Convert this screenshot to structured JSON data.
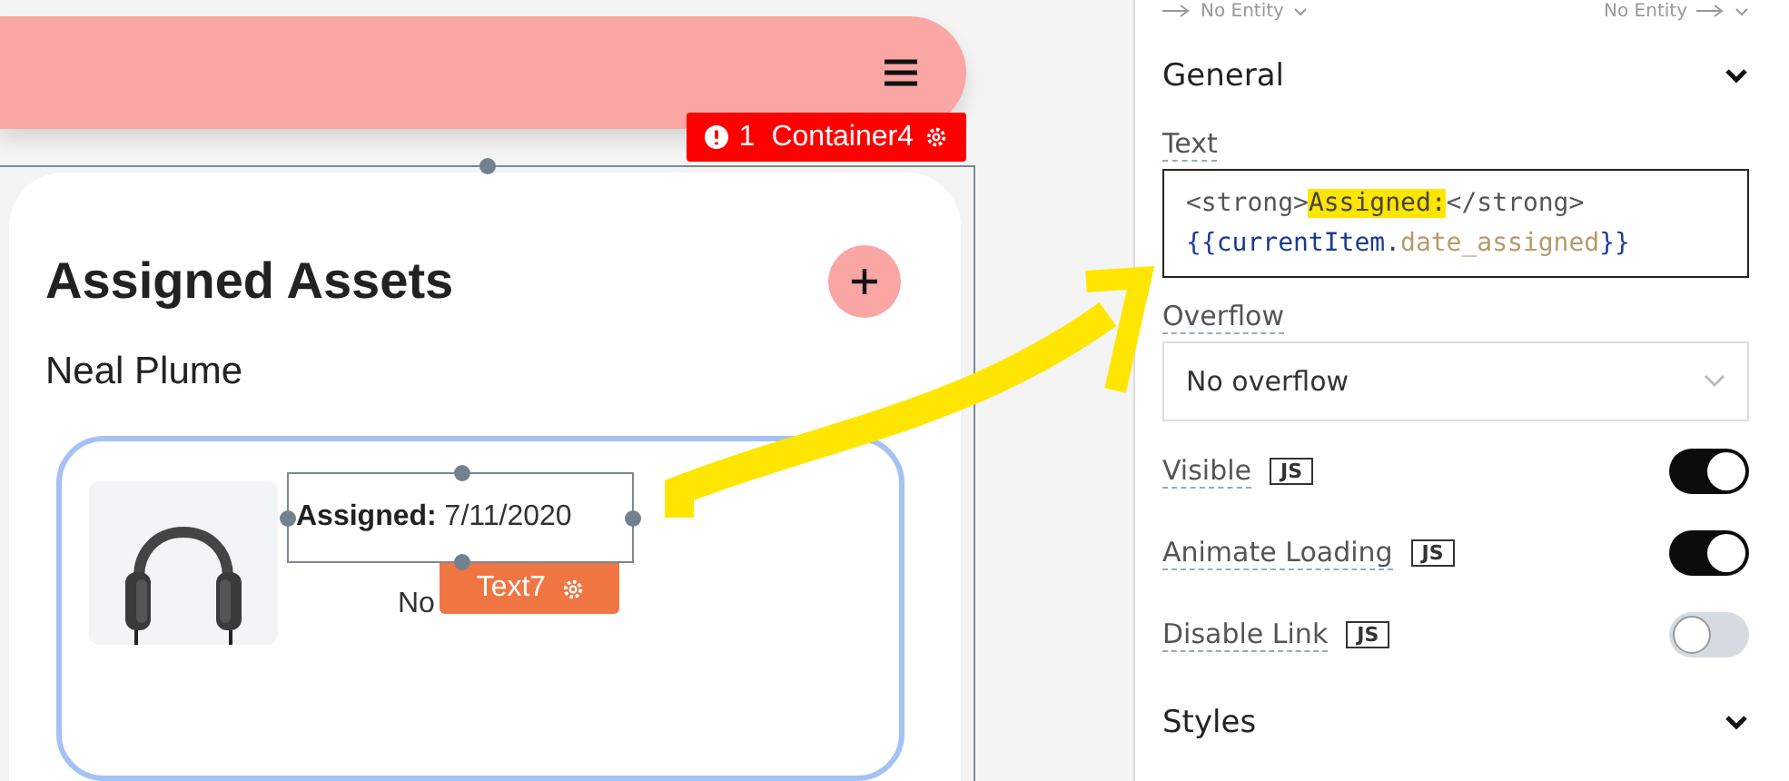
{
  "canvas": {
    "error_badge": {
      "count": "1",
      "label": "Container4"
    },
    "card": {
      "title": "Assigned Assets",
      "subtitle": "Neal Plume",
      "list_item": {
        "assigned_label": "Assigned:",
        "assigned_value": "7/11/2020",
        "status_text": "No",
        "selected_widget": "Text7"
      }
    }
  },
  "panel": {
    "entity_from": "No Entity",
    "entity_to": "No Entity",
    "general": {
      "title": "General"
    },
    "text_field": {
      "label": "Text",
      "lines": [
        [
          {
            "kind": "tag",
            "text": "<strong>",
            "highlighted": false
          },
          {
            "kind": "plain",
            "text": "Assigned:",
            "highlighted": true
          },
          {
            "kind": "tag",
            "text": "</strong>",
            "highlighted": false
          }
        ],
        [
          {
            "kind": "brace",
            "text": "{{",
            "highlighted": false
          },
          {
            "kind": "ident",
            "text": "currentItem",
            "highlighted": false
          },
          {
            "kind": "plain",
            "text": ".",
            "highlighted": false
          },
          {
            "kind": "prop",
            "text": "date_assigned",
            "highlighted": false
          },
          {
            "kind": "brace",
            "text": "}}",
            "highlighted": false
          }
        ]
      ]
    },
    "overflow": {
      "label": "Overflow",
      "value": "No overflow"
    },
    "toggles": [
      {
        "label": "Visible",
        "badge": "JS",
        "on": true
      },
      {
        "label": "Animate Loading",
        "badge": "JS",
        "on": true
      },
      {
        "label": "Disable Link",
        "badge": "JS",
        "on": false
      }
    ],
    "styles": {
      "title": "Styles"
    }
  }
}
